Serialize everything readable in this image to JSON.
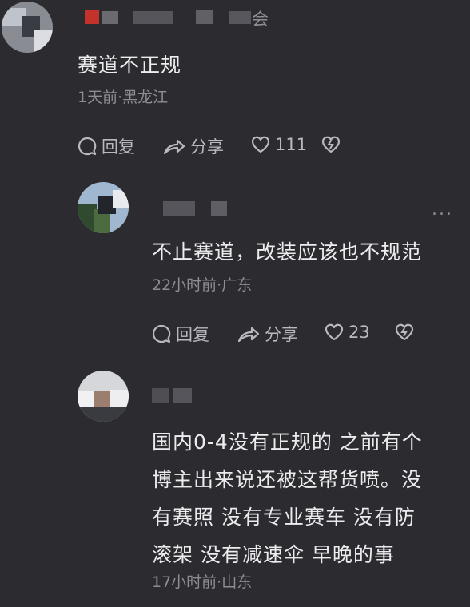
{
  "comments": [
    {
      "content": "赛道不正规",
      "time_location": "1天前·黑龙江",
      "reply_label": "回复",
      "share_label": "分享",
      "like_count": "111",
      "username_visible_char": "会"
    },
    {
      "content": "不止赛道，改装应该也不规范",
      "time_location": "22小时前·广东",
      "reply_label": "回复",
      "share_label": "分享",
      "like_count": "23",
      "more_label": "..."
    },
    {
      "content_lines": [
        "国内0-4没有正规的 之前有个",
        "博主出来说还被这帮货喷。没",
        "有赛照 没有专业赛车 没有防",
        "滚架 没有减速伞 早晚的事"
      ],
      "time_location": "17小时前·山东"
    }
  ],
  "colors": {
    "background": "#2b2b30",
    "text": "#ececee",
    "meta": "#8d8d93",
    "action": "#b9b9bf"
  },
  "icons": [
    "comment-bubble-icon",
    "share-arrow-icon",
    "heart-icon",
    "broken-heart-icon",
    "more-dots-icon"
  ]
}
